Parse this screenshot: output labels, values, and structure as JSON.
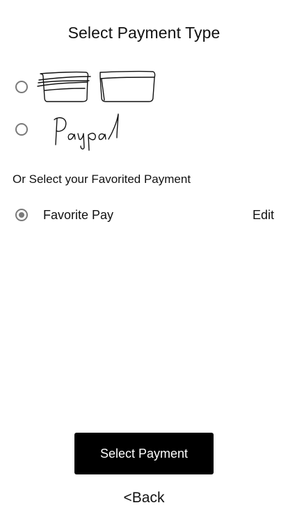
{
  "header": {
    "title": "Select Payment Type"
  },
  "payment_types": [
    {
      "icon": "credit-card-sketch-icon",
      "selected": false
    },
    {
      "icon": "paypal-handwritten-logo",
      "logo_text": "Paypal",
      "selected": false
    }
  ],
  "favorites": {
    "section_label": "Or Select your Favorited Payment",
    "items": [
      {
        "label": "Favorite Pay",
        "edit_label": "Edit",
        "selected": true
      }
    ]
  },
  "actions": {
    "primary_label": "Select Payment",
    "back_label": "<Back"
  },
  "colors": {
    "background": "#ffffff",
    "text": "#111111",
    "radio": "#7a7a7a",
    "button_bg": "#000000",
    "button_text": "#ffffff"
  }
}
